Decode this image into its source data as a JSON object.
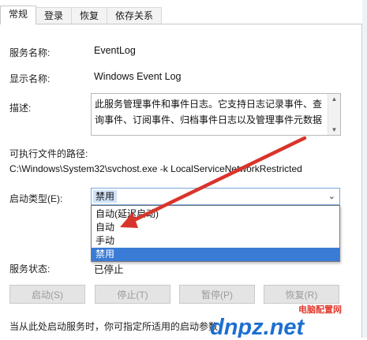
{
  "tabs": [
    {
      "label": "常规"
    },
    {
      "label": "登录"
    },
    {
      "label": "恢复"
    },
    {
      "label": "依存关系"
    }
  ],
  "service_name": {
    "label": "服务名称:",
    "value": "EventLog"
  },
  "display_name": {
    "label": "显示名称:",
    "value": "Windows Event Log"
  },
  "description": {
    "label": "描述:",
    "text": "此服务管理事件和事件日志。它支持日志记录事件、查询事件、订阅事件、归档事件日志以及管理事件元数据"
  },
  "executable": {
    "label": "可执行文件的路径:",
    "path": "C:\\Windows\\System32\\svchost.exe -k LocalServiceNetworkRestricted"
  },
  "startup": {
    "label": "启动类型(E):",
    "selected": "禁用",
    "options": [
      {
        "label": "自动(延迟启动)"
      },
      {
        "label": "自动"
      },
      {
        "label": "手动"
      },
      {
        "label": "禁用"
      }
    ]
  },
  "status": {
    "label": "服务状态:",
    "value": "已停止"
  },
  "buttons": {
    "start": "启动(S)",
    "stop": "停止(T)",
    "pause": "暂停(P)",
    "resume": "恢复(R)"
  },
  "footer_note": "当从此处启动服务时，你可指定所适用的启动参数",
  "watermark": {
    "top_text": "电脑配置网",
    "brand": "dnpz.net"
  },
  "colors": {
    "annotation_arrow": "#d9342b",
    "highlight": "#3a7bd5",
    "watermark_blue": "#1d6fd1",
    "watermark_red": "#e23b2e"
  }
}
